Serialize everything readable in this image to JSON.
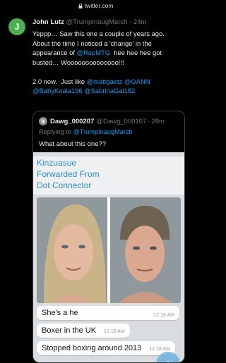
{
  "browser": {
    "url": "twitter.com"
  },
  "tweet": {
    "avatar_letter": "J",
    "avatar_color": "#4caf50",
    "name": "John Lutz",
    "handle": "@TrumpInaugMarch",
    "dot": "·",
    "time": "24m",
    "text": {
      "line1": "Yeppp… Saw this one a couple of years ago.",
      "line2": "About the time I noticed a 'change' in the",
      "line3_pre": "appearance of ",
      "line3_mention": "@RepMTG",
      "line3_post": "  hee hee hee got",
      "line4": "busted…  Woooooooooooooo!!!",
      "line5_pre": "2.0 now.  Just like ",
      "mention_gaetz": "@mattgaetz",
      "mention_oann": "@OANN",
      "mention_koala": "@BabyKoala196",
      "mention_sabrina": "@SabrinaGal182"
    }
  },
  "quote": {
    "name": "Dawg_000207",
    "handle": "@Dawg_000107",
    "dot": "·",
    "time": "28m",
    "replying_label": "Replying to ",
    "replying_handle": "@TrumpInaugMarch",
    "text": "What about this one??",
    "media": {
      "fwd_line1": "Kinzuasue",
      "fwd_line2": "Forwarded From",
      "fwd_line3": "Dot Connector",
      "messages": [
        {
          "text": "She's a he",
          "time": "12:18 AM"
        },
        {
          "text": "Boxer in the UK",
          "time": "12:18 AM"
        },
        {
          "text": "Stopped boxing around 2013",
          "time": "12:18 AM"
        }
      ]
    }
  },
  "colors": {
    "accent": "#1d9bf0",
    "muted": "#71767b",
    "background": "#000000"
  }
}
